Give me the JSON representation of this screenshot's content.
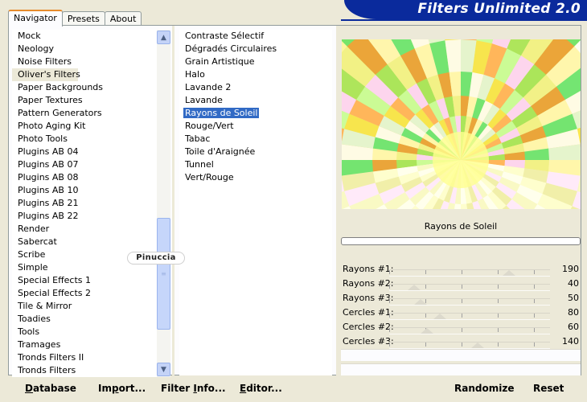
{
  "tabs": [
    {
      "label": "Navigator",
      "active": true
    },
    {
      "label": "Presets",
      "active": false
    },
    {
      "label": "About",
      "active": false
    }
  ],
  "app_title": "Filters Unlimited 2.0",
  "categories": [
    "Mock",
    "Neology",
    "Noise Filters",
    "Oliver's Filters",
    "Paper Backgrounds",
    "Paper Textures",
    "Pattern Generators",
    "Photo Aging Kit",
    "Photo Tools",
    "Plugins AB 04",
    "Plugins AB 07",
    "Plugins AB 08",
    "Plugins AB 10",
    "Plugins AB 21",
    "Plugins AB 22",
    "Render",
    "Sabercat",
    "Scribe",
    "Simple",
    "Special Effects 1",
    "Special Effects 2",
    "Tile & Mirror",
    "Toadies",
    "Tools",
    "Tramages",
    "Tronds Filters II",
    "Tronds Filters"
  ],
  "selected_category": "Oliver's Filters",
  "filters": [
    "Contraste Sélectif",
    "Dégradés Circulaires",
    "Grain Artistique",
    "Halo",
    "Lavande 2",
    "Lavande",
    "Rayons de Soleil",
    "Rouge/Vert",
    "Tabac",
    "Toile d'Araignée",
    "Tunnel",
    "Vert/Rouge"
  ],
  "selected_filter": "Rayons de Soleil",
  "preview": {
    "filter_name": "Rayons de Soleil"
  },
  "sliders": [
    {
      "label": "Rayons #1:",
      "value": "190",
      "level": 190
    },
    {
      "label": "Rayons #2:",
      "value": "40",
      "level": 40
    },
    {
      "label": "Rayons #3:",
      "value": "50",
      "level": 50
    },
    {
      "label": "Cercles #1:",
      "value": "80",
      "level": 80
    },
    {
      "label": "Cercles #2:",
      "value": "60",
      "level": 60
    },
    {
      "label": "Cercles #3:",
      "value": "140",
      "level": 140
    }
  ],
  "buttons": {
    "database": {
      "u": "D",
      "rest": "atabase"
    },
    "import": {
      "pre": "Im",
      "u": "p",
      "rest": "ort..."
    },
    "filter_info": {
      "pre": "Filter ",
      "u": "I",
      "rest": "nfo..."
    },
    "editor": {
      "u": "E",
      "rest": "ditor..."
    },
    "randomize": "Randomize",
    "reset": "Reset"
  },
  "watermark": "Pinuccia",
  "colors": {
    "accent_tab": "#e68b2c",
    "banner": "#0a2a9c",
    "selection": "#316ac5"
  }
}
